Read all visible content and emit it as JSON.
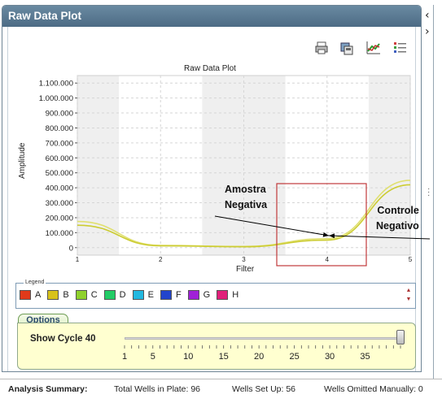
{
  "panel": {
    "title": "Raw Data Plot"
  },
  "toolbar": {
    "icons": [
      "print-icon",
      "save-image-icon",
      "chart-options-icon",
      "legend-list-icon"
    ]
  },
  "chart_data": {
    "type": "line",
    "title": "Raw Data Plot",
    "xlabel": "Filter",
    "ylabel": "Amplitude",
    "x": [
      1,
      2,
      3,
      4,
      5
    ],
    "xlim": [
      1,
      5
    ],
    "ylim": [
      -50000,
      1150000
    ],
    "y_ticks": [
      "0",
      "100.000",
      "200.000",
      "300.000",
      "400.000",
      "500.000",
      "600.000",
      "700.000",
      "800.000",
      "900.000",
      "1.000.000",
      "1.100.000"
    ],
    "x_ticks": [
      "1",
      "2",
      "3",
      "4",
      "5"
    ],
    "series": [
      {
        "values": [
          175000,
          15000,
          8000,
          60000,
          450000
        ],
        "color": "#e0e070"
      },
      {
        "values": [
          150000,
          12000,
          6000,
          50000,
          420000
        ],
        "color": "#cccc33"
      }
    ],
    "grid": true
  },
  "annotations": {
    "amostra": [
      "Amostra",
      "Negativa"
    ],
    "controle": [
      "Controle",
      "Negativo"
    ]
  },
  "legend": {
    "title": "Legend",
    "items": [
      {
        "label": "A",
        "color": "#e03a1a"
      },
      {
        "label": "B",
        "color": "#d8c21a"
      },
      {
        "label": "C",
        "color": "#8fd12c"
      },
      {
        "label": "D",
        "color": "#22cc66"
      },
      {
        "label": "E",
        "color": "#22b8e0"
      },
      {
        "label": "F",
        "color": "#2244cc"
      },
      {
        "label": "G",
        "color": "#a020d8"
      },
      {
        "label": "H",
        "color": "#e0207a"
      }
    ]
  },
  "options": {
    "tab_label": "Options",
    "show_cycle_label": "Show Cycle",
    "show_cycle_value": "40",
    "slider_value": 40,
    "slider_ticks": [
      "1",
      "5",
      "10",
      "15",
      "20",
      "25",
      "30",
      "35"
    ]
  },
  "summary": {
    "title": "Analysis Summary:",
    "total_wells": "Total Wells in Plate: 96",
    "wells_set_up": "Wells Set Up: 56",
    "wells_omitted": "Wells Omitted Manually: 0"
  }
}
